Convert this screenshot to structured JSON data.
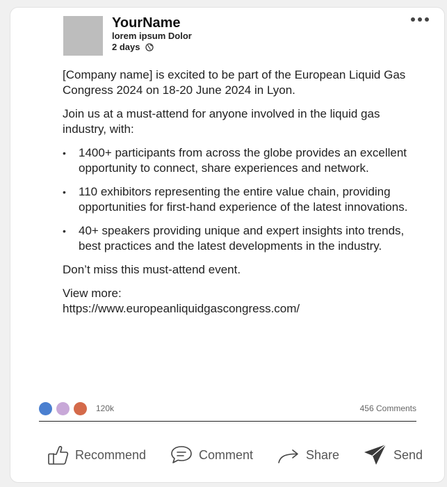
{
  "author": {
    "name": "YourName",
    "headline": "lorem ipsum Dolor",
    "time": "2 days",
    "icons": {
      "avatar": "avatar-placeholder",
      "visibility": "globe-icon",
      "menu": "more-options-icon"
    }
  },
  "post": {
    "intro": "[Company name] is excited to be part of the European Liquid Gas Congress 2024 on 18-20 June 2024 in Lyon.",
    "lead": "Join us at a must-attend for anyone involved in the liquid gas industry, with:",
    "bullets": [
      "1400+ participants from across the globe provides an excellent opportunity to connect, share experiences and network.",
      "110 exhibitors representing the entire value chain, providing opportunities for first-hand experience of the latest innovations.",
      "40+ speakers providing unique and expert insights into trends, best practices and the latest developments in the industry."
    ],
    "closing": "Don’t miss this must-attend event.",
    "view_more_label": "View more:",
    "link": "https://www.europeanliquidgascongress.com/"
  },
  "stats": {
    "reactions_count": "120k",
    "comments_count": "456 Comments",
    "reaction_colors": [
      "#4a7fd0",
      "#c8a8d8",
      "#d46a4a"
    ]
  },
  "actions": [
    {
      "label": "Recommend",
      "icon": "thumbs-up-icon"
    },
    {
      "label": "Comment",
      "icon": "comment-icon"
    },
    {
      "label": "Share",
      "icon": "share-arrow-icon"
    },
    {
      "label": "Send",
      "icon": "send-icon"
    }
  ]
}
